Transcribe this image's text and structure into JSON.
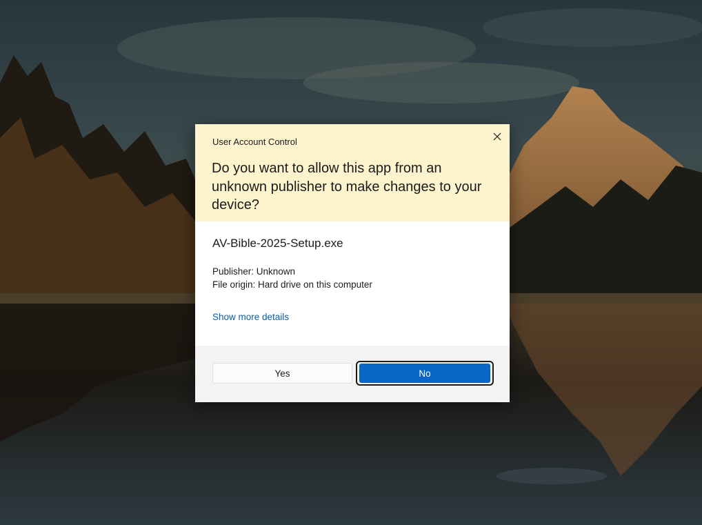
{
  "dialog": {
    "title": "User Account Control",
    "question": "Do you want to allow this app from an unknown publisher to make changes to your device?",
    "app_name": "AV-Bible-2025-Setup.exe",
    "publisher": "Publisher: Unknown",
    "file_origin": "File origin: Hard drive on this computer",
    "details_link": "Show more details",
    "yes_label": "Yes",
    "no_label": "No",
    "header_color": "#fdf3cd",
    "primary_color": "#0a67c8",
    "link_color": "#0a5ea8",
    "focused_button": "No",
    "close_icon": "close-icon"
  },
  "background": {
    "description_icon": "wallpaper-image"
  }
}
